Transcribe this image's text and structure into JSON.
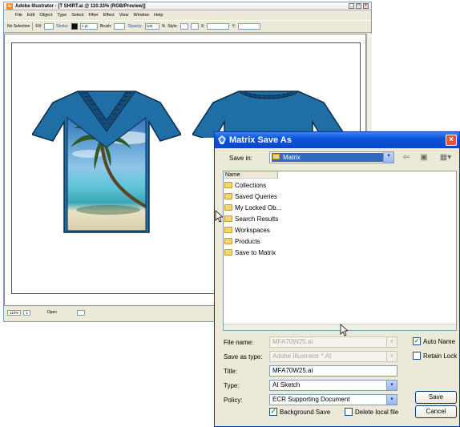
{
  "illustrator": {
    "title": "Adobe Illustrator - [T SHIRT.ai @ 110.33% (RGB/Preview)]",
    "logo": "Ai",
    "window_controls": [
      "_",
      "□",
      "×"
    ],
    "menus": [
      "File",
      "Edit",
      "Object",
      "Type",
      "Select",
      "Filter",
      "Effect",
      "View",
      "Window",
      "Help"
    ],
    "control_bar": {
      "selection": "No Selection",
      "fill_label": "Fill:",
      "stroke_label": "Stroke:",
      "stroke_weight": "1 pt",
      "brush_label": "Brush:",
      "opacity_label": "Opacity:",
      "opacity_value": "100",
      "opacity_unit": "%",
      "style_label": "Style:",
      "x_label": "X:",
      "y_label": "Y:"
    },
    "status_bar": {
      "zoom": "110%",
      "page": "1",
      "status": "Open"
    }
  },
  "dialog": {
    "title": "Matrix Save As",
    "close_glyph": "×",
    "save_in_label": "Save in:",
    "save_in_value": "Matrix",
    "list_header": "Name",
    "folders": [
      "Collections",
      "Saved Queries",
      "My Locked Ob...",
      "Search Results",
      "Workspaces",
      "Products",
      "Save to Matrix"
    ],
    "fields": {
      "file_name_label": "File name:",
      "file_name_value": "MFA70W25.ai",
      "save_as_type_label": "Save as type:",
      "save_as_type_value": "Adobe Illustrator *.AI",
      "title_label": "Title:",
      "title_value": "MFA70W25.ai",
      "type_label": "Type:",
      "type_value": "AI Sketch",
      "policy_label": "Policy:",
      "policy_value": "ECR Supporting Document"
    },
    "checkboxes": {
      "auto_name": {
        "label": "Auto Name",
        "checked": true
      },
      "retain_lock": {
        "label": "Retain Lock",
        "checked": false
      },
      "background_save": {
        "label": "Background Save",
        "checked": true
      },
      "delete_local_file": {
        "label": "Delete local file",
        "checked": false
      }
    },
    "buttons": {
      "save": "Save",
      "cancel": "Cancel"
    },
    "colors": {
      "titlebar": "#0b55dc",
      "selection": "#316ac5"
    }
  },
  "artwork": {
    "shirt_color": "#1f6fa6",
    "icons": [
      "tshirt-front-icon",
      "tshirt-back-icon"
    ]
  }
}
